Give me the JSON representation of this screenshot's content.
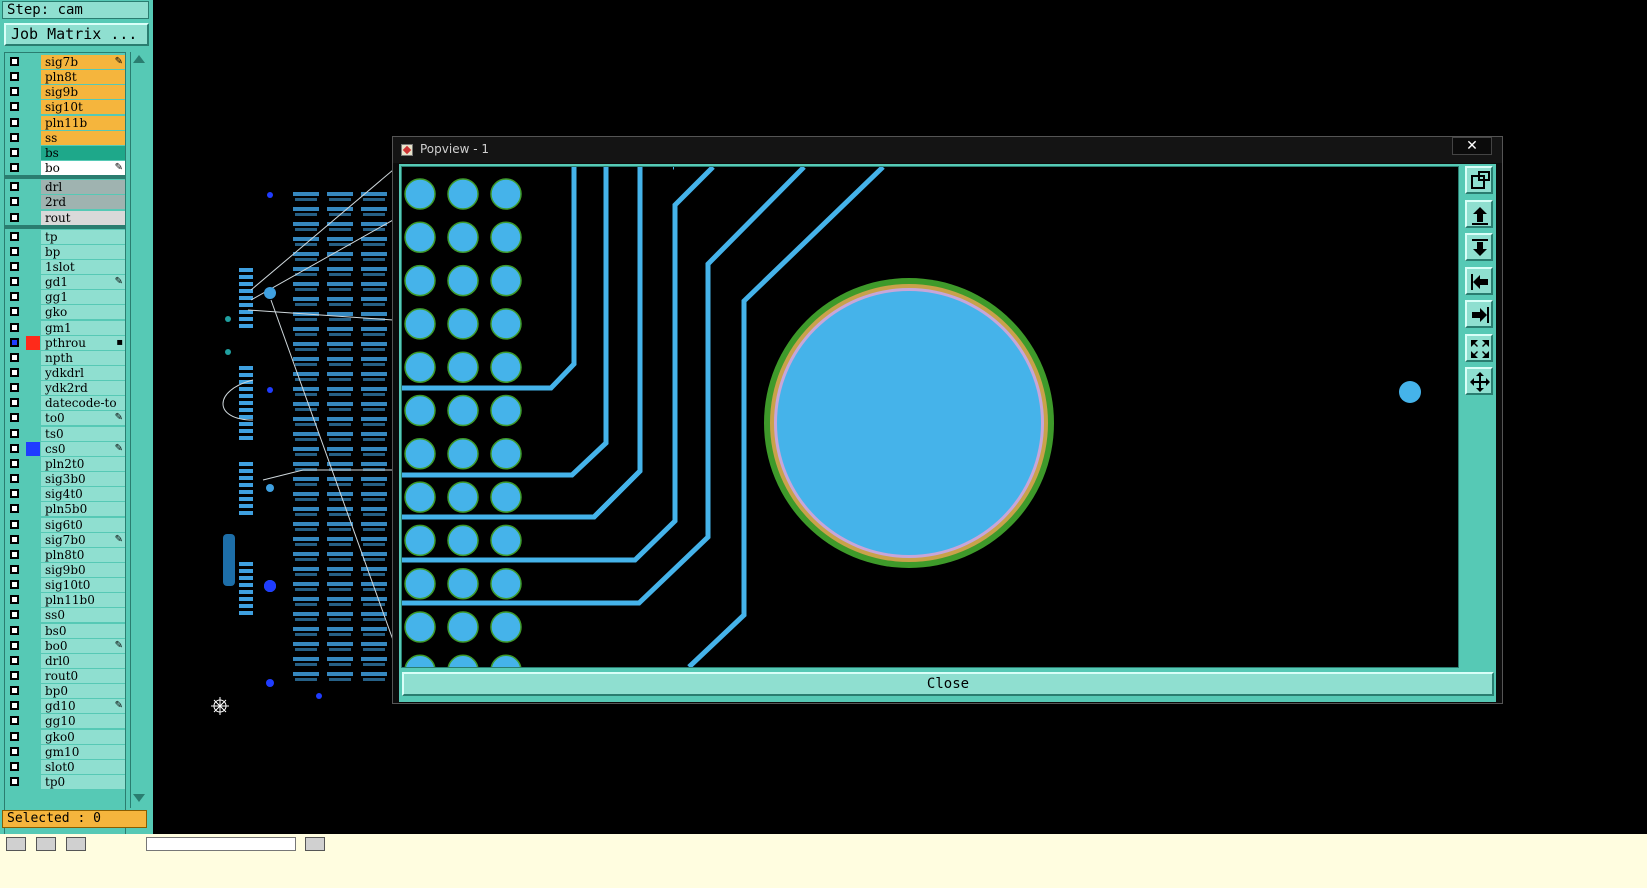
{
  "panel": {
    "step_label": "Step: cam",
    "job_matrix_label": "Job Matrix ...",
    "selected_label": "Selected : 0"
  },
  "layers": [
    {
      "name": "sig7b",
      "color": "orange",
      "mark": true
    },
    {
      "name": "pln8t",
      "color": "orange",
      "mark": false
    },
    {
      "name": "sig9b",
      "color": "orange",
      "mark": false
    },
    {
      "name": "sig10t",
      "color": "orange",
      "mark": false
    },
    {
      "name": "pln11b",
      "color": "orange",
      "mark": false
    },
    {
      "name": "ss",
      "color": "orange",
      "mark": false
    },
    {
      "name": "bs",
      "color": "green",
      "mark": false
    },
    {
      "name": "bo",
      "color": "white",
      "mark": true
    },
    {
      "name": "drl",
      "color": "gray",
      "mark": false
    },
    {
      "name": "2rd",
      "color": "gray",
      "mark": false
    },
    {
      "name": "rout",
      "color": "lightgray",
      "mark": false
    },
    {
      "name": "tp",
      "color": "teal",
      "mark": false
    },
    {
      "name": "bp",
      "color": "teal",
      "mark": false
    },
    {
      "name": "1slot",
      "color": "teal",
      "mark": false
    },
    {
      "name": "gd1",
      "color": "teal",
      "mark": true
    },
    {
      "name": "gg1",
      "color": "teal",
      "mark": false
    },
    {
      "name": "gko",
      "color": "teal",
      "mark": false
    },
    {
      "name": "gm1",
      "color": "teal",
      "mark": false
    },
    {
      "name": "pthrou",
      "color": "teal",
      "mark": false,
      "checked": true,
      "swatch": "#ff2a1a"
    },
    {
      "name": "npth",
      "color": "teal",
      "mark": false
    },
    {
      "name": "ydkdrl",
      "color": "teal",
      "mark": false
    },
    {
      "name": "ydk2rd",
      "color": "teal",
      "mark": false
    },
    {
      "name": "datecode-to",
      "color": "teal",
      "mark": false
    },
    {
      "name": "to0",
      "color": "teal",
      "mark": true
    },
    {
      "name": "ts0",
      "color": "teal",
      "mark": false
    },
    {
      "name": "cs0",
      "color": "teal",
      "mark": true,
      "swatch": "#1f3cff"
    },
    {
      "name": "pln2t0",
      "color": "teal",
      "mark": false
    },
    {
      "name": "sig3b0",
      "color": "teal",
      "mark": false
    },
    {
      "name": "sig4t0",
      "color": "teal",
      "mark": false
    },
    {
      "name": "pln5b0",
      "color": "teal",
      "mark": false
    },
    {
      "name": "sig6t0",
      "color": "teal",
      "mark": false
    },
    {
      "name": "sig7b0",
      "color": "teal",
      "mark": true
    },
    {
      "name": "pln8t0",
      "color": "teal",
      "mark": false
    },
    {
      "name": "sig9b0",
      "color": "teal",
      "mark": false
    },
    {
      "name": "sig10t0",
      "color": "teal",
      "mark": false
    },
    {
      "name": "pln11b0",
      "color": "teal",
      "mark": false
    },
    {
      "name": "ss0",
      "color": "teal",
      "mark": false
    },
    {
      "name": "bs0",
      "color": "teal",
      "mark": false
    },
    {
      "name": "bo0",
      "color": "teal",
      "mark": true
    },
    {
      "name": "drl0",
      "color": "teal",
      "mark": false
    },
    {
      "name": "rout0",
      "color": "teal",
      "mark": false
    },
    {
      "name": "bp0",
      "color": "teal",
      "mark": false
    },
    {
      "name": "gd10",
      "color": "teal",
      "mark": true
    },
    {
      "name": "gg10",
      "color": "teal",
      "mark": false
    },
    {
      "name": "gko0",
      "color": "teal",
      "mark": false
    },
    {
      "name": "gm10",
      "color": "teal",
      "mark": false
    },
    {
      "name": "slot0",
      "color": "teal",
      "mark": false
    },
    {
      "name": "tp0",
      "color": "teal",
      "mark": false
    }
  ],
  "popview": {
    "title": "Popview - 1",
    "close_x": "✕",
    "close_label": "Close",
    "tools": [
      "zoom-window-icon",
      "zoom-in-icon",
      "zoom-out-icon",
      "pan-left-icon",
      "pan-right-icon",
      "fit-all-icon",
      "pan-center-icon"
    ]
  },
  "colors": {
    "panel": "#56c9b5",
    "pad": "#45b3ea",
    "board_feature": "#3fa0e0",
    "selected_feature": "#1f3cff"
  }
}
